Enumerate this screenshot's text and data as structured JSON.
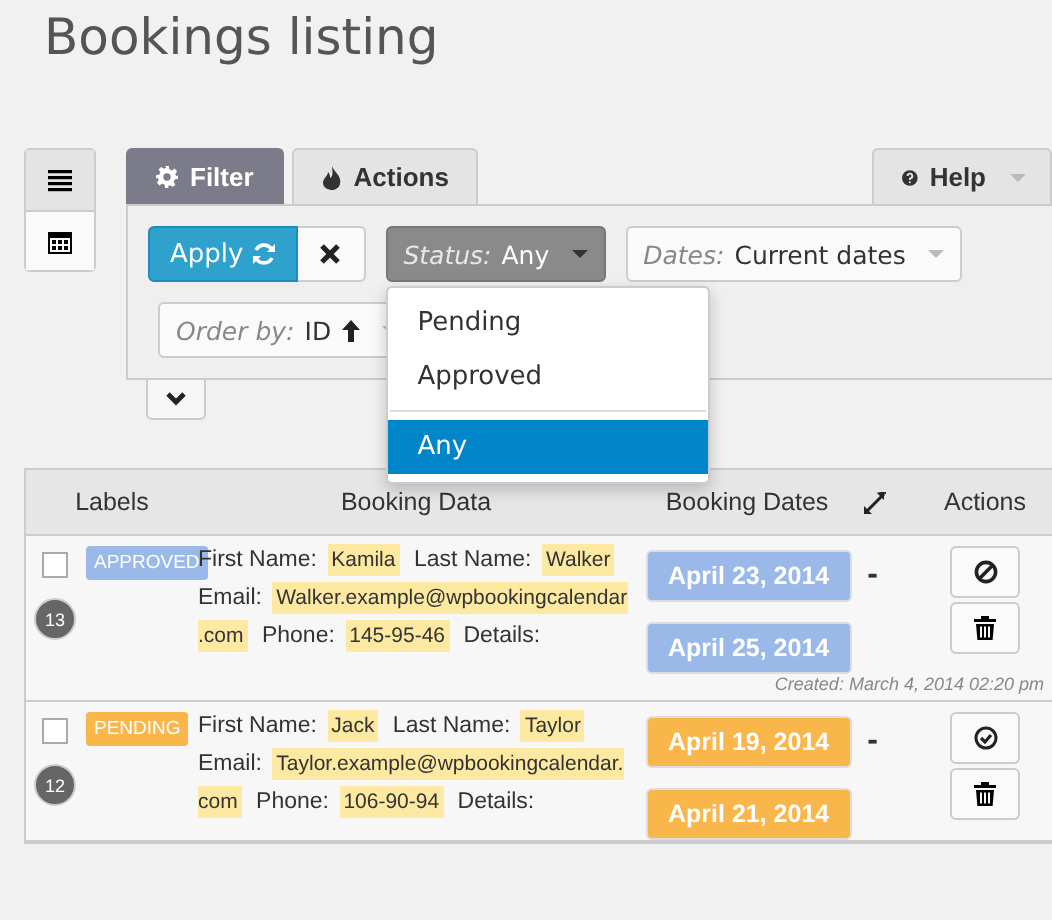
{
  "title": "Bookings listing",
  "view_switch": [
    {
      "kind": "list",
      "selected": true
    },
    {
      "kind": "calendar",
      "selected": false
    }
  ],
  "tabs": [
    {
      "label": "Filter",
      "kind": "filter",
      "selected": true
    },
    {
      "label": "Actions",
      "kind": "actions",
      "selected": false
    }
  ],
  "help": {
    "label": "Help"
  },
  "filter": {
    "apply": "Apply",
    "status": {
      "label": "Status:",
      "value": "Any",
      "open": true
    },
    "dates": {
      "label": "Dates:",
      "value": "Current dates"
    },
    "order": {
      "label": "Order by:",
      "value": "ID"
    }
  },
  "status_menu": [
    {
      "label": "Pending",
      "selected": false
    },
    {
      "label": "Approved",
      "selected": false
    },
    {
      "label": "Any",
      "selected": true
    }
  ],
  "table": {
    "columns": [
      "Labels",
      "Booking Data",
      "Booking Dates",
      "Actions"
    ],
    "rows": [
      {
        "checked": false,
        "kind": "approved",
        "label": "APPROVED",
        "id": "13",
        "fields": [
          {
            "label": "First Name:",
            "value": "Kamila"
          },
          {
            "label": "Last Name:",
            "value": "Walker"
          },
          {
            "label": "Email:",
            "value": "Walker.example@wpbookingcalendar.com"
          },
          {
            "label": "Phone:",
            "value": "145-95-46"
          },
          {
            "label": "Details:"
          }
        ],
        "dates": [
          "April 23, 2014",
          "April 25, 2014"
        ],
        "separator": "-",
        "created": "Created: March 4, 2014 02:20 pm"
      },
      {
        "checked": false,
        "kind": "pending",
        "label": "PENDING",
        "id": "12",
        "fields": [
          {
            "label": "First Name:",
            "value": "Jack"
          },
          {
            "label": "Last Name:",
            "value": "Taylor"
          },
          {
            "label": "Email:",
            "value": "Taylor.example@wpbookingcalendar.com"
          },
          {
            "label": "Phone:",
            "value": "106-90-94"
          },
          {
            "label": "Details:"
          }
        ],
        "dates": [
          "April 19, 2014",
          "April 21, 2014"
        ],
        "separator": "-"
      }
    ]
  }
}
